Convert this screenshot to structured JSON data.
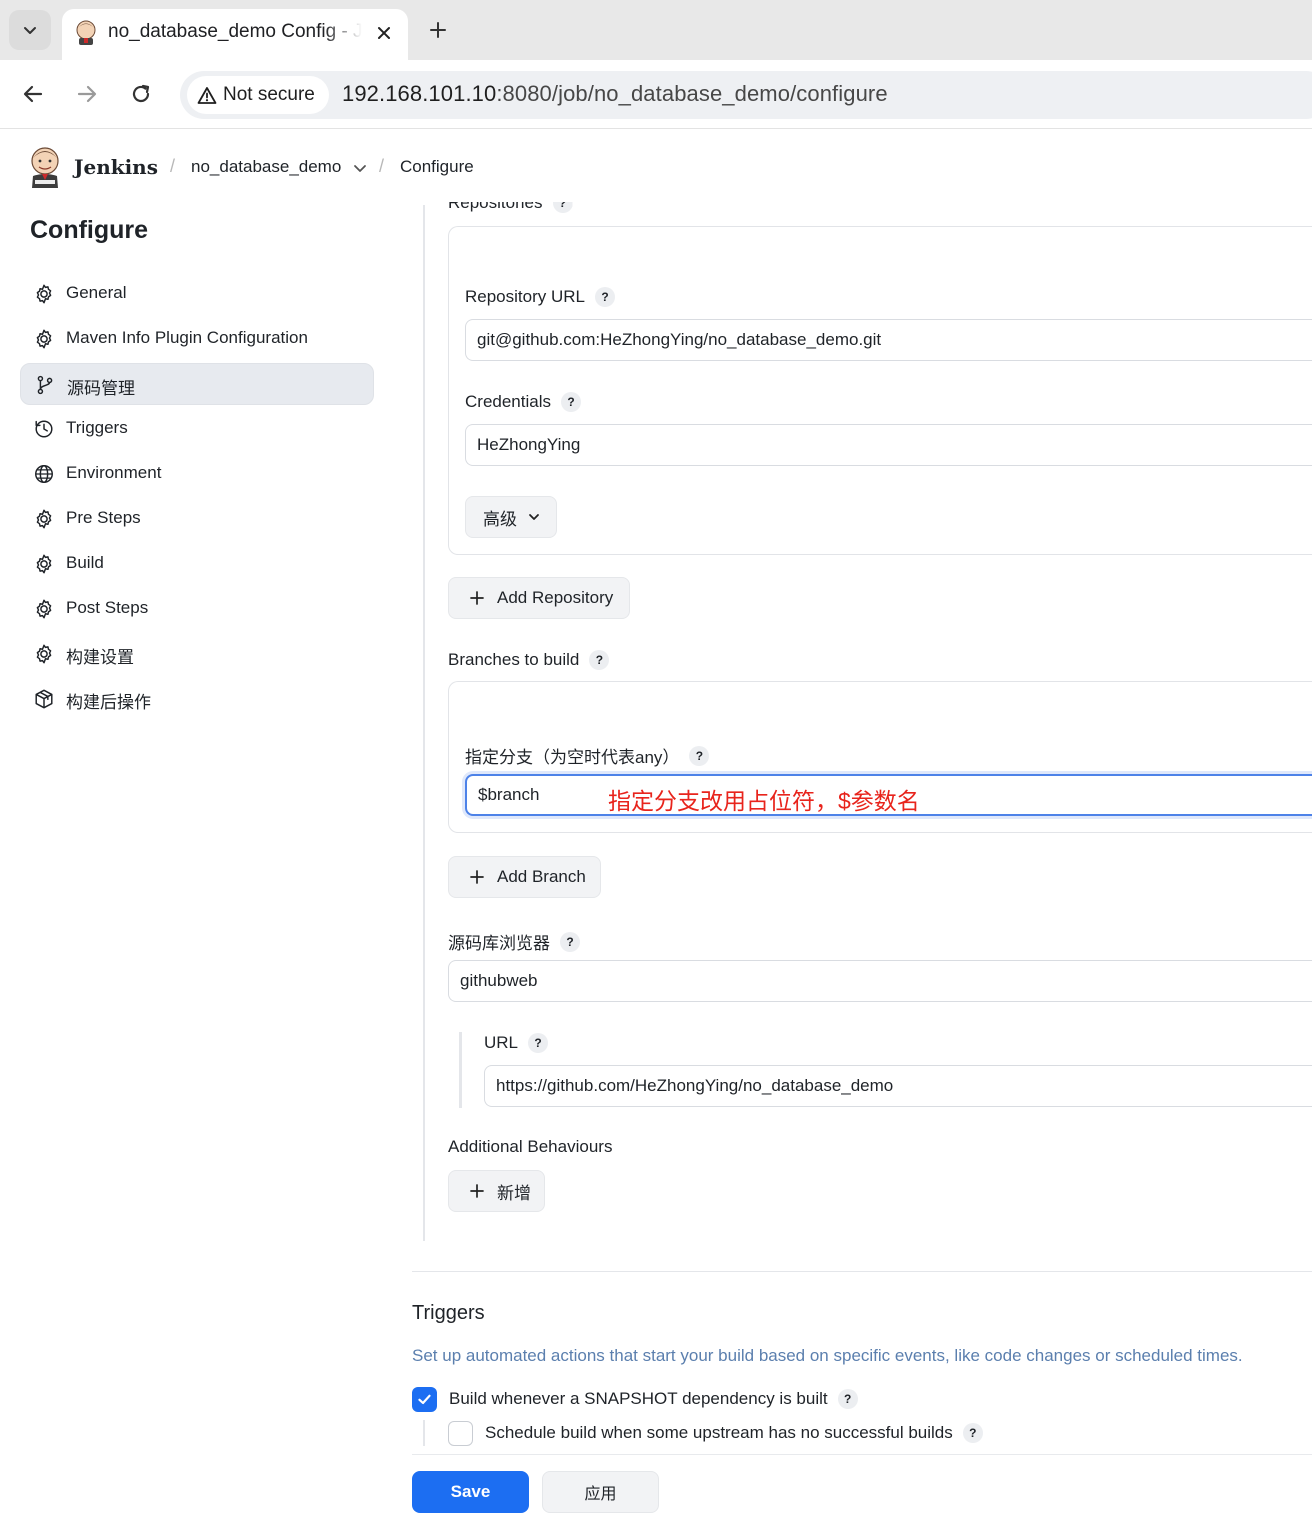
{
  "browser": {
    "tab_title": "no_database_demo Config - Jenkins",
    "security_label": "Not secure",
    "url_host": "192.168.101.10",
    "url_rest": ":8080/job/no_database_demo/configure"
  },
  "header": {
    "app_name": "Jenkins",
    "breadcrumb": [
      "no_database_demo",
      "Configure"
    ]
  },
  "sidebar": {
    "title": "Configure",
    "active_index": 2,
    "items": [
      {
        "label": "General",
        "icon": "gear-icon"
      },
      {
        "label": "Maven Info Plugin Configuration",
        "icon": "gear-icon"
      },
      {
        "label": "源码管理",
        "icon": "git-branch-icon"
      },
      {
        "label": "Triggers",
        "icon": "clock-icon"
      },
      {
        "label": "Environment",
        "icon": "globe-icon"
      },
      {
        "label": "Pre Steps",
        "icon": "gear-icon"
      },
      {
        "label": "Build",
        "icon": "gear-icon"
      },
      {
        "label": "Post Steps",
        "icon": "gear-icon"
      },
      {
        "label": "构建设置",
        "icon": "gear-icon"
      },
      {
        "label": "构建后操作",
        "icon": "package-icon"
      }
    ]
  },
  "scm": {
    "repositories_label": "Repositories",
    "repo_url_label": "Repository URL",
    "repo_url_value": "git@github.com:HeZhongYing/no_database_demo.git",
    "credentials_label": "Credentials",
    "credentials_value": "HeZhongYing",
    "advanced_label": "高级",
    "add_repository_label": "Add Repository",
    "branches_label": "Branches to build",
    "branch_specifier_label": "指定分支（为空时代表any）",
    "branch_specifier_value": "$branch",
    "annotation": "指定分支改用占位符，$参数名",
    "add_branch_label": "Add Branch",
    "browser_label": "源码库浏览器",
    "browser_value": "githubweb",
    "browser_url_label": "URL",
    "browser_url_value": "https://github.com/HeZhongYing/no_database_demo",
    "additional_label": "Additional Behaviours",
    "add_behaviour_label": "新增"
  },
  "triggers": {
    "title": "Triggers",
    "description": "Set up automated actions that start your build based on specific events, like code changes or scheduled times.",
    "options": [
      {
        "label": "Build whenever a SNAPSHOT dependency is built",
        "checked": true
      },
      {
        "label": "Schedule build when some upstream has no successful builds",
        "checked": false
      }
    ]
  },
  "footer": {
    "save_label": "Save",
    "apply_label": "应用"
  },
  "colors": {
    "primary": "#1c6ef2",
    "annotation": "#e8241c",
    "description": "#5b7fae",
    "active_nav": "#e7eaef"
  }
}
